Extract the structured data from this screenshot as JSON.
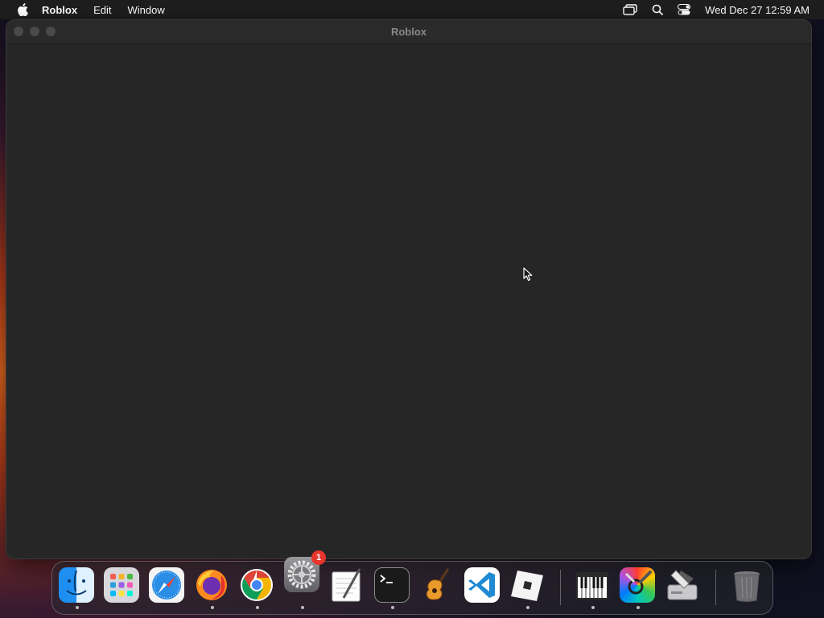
{
  "menubar": {
    "app_name": "Roblox",
    "items": [
      "Edit",
      "Window"
    ],
    "clock": "Wed Dec 27  12:59 AM",
    "status_icons": [
      "screen-mirroring-icon",
      "spotlight-search-icon",
      "control-center-icon"
    ]
  },
  "window": {
    "title": "Roblox"
  },
  "dock": {
    "apps": [
      {
        "name": "Finder",
        "icon": "finder-icon",
        "running": true
      },
      {
        "name": "Launchpad",
        "icon": "launchpad-icon",
        "running": false
      },
      {
        "name": "Safari",
        "icon": "safari-icon",
        "running": false
      },
      {
        "name": "Firefox",
        "icon": "firefox-icon",
        "running": true
      },
      {
        "name": "Google Chrome",
        "icon": "chrome-icon",
        "running": true
      },
      {
        "name": "System Settings",
        "icon": "system-settings-icon",
        "running": true,
        "badge": "1"
      },
      {
        "name": "TextEdit",
        "icon": "textedit-icon",
        "running": false
      },
      {
        "name": "Terminal",
        "icon": "terminal-icon",
        "running": true
      },
      {
        "name": "GarageBand",
        "icon": "garageband-icon",
        "running": false
      },
      {
        "name": "Visual Studio Code",
        "icon": "vscode-icon",
        "running": false
      },
      {
        "name": "Roblox",
        "icon": "roblox-icon",
        "running": true
      },
      {
        "name": "MIDI Keyboard",
        "icon": "piano-keyboard-icon",
        "running": true
      },
      {
        "name": "ColorSync Utility",
        "icon": "colorsync-utility-icon",
        "running": true
      },
      {
        "name": "Disk Utility",
        "icon": "disk-utility-icon",
        "running": false
      },
      {
        "name": "Trash",
        "icon": "trash-icon",
        "running": false
      }
    ]
  }
}
